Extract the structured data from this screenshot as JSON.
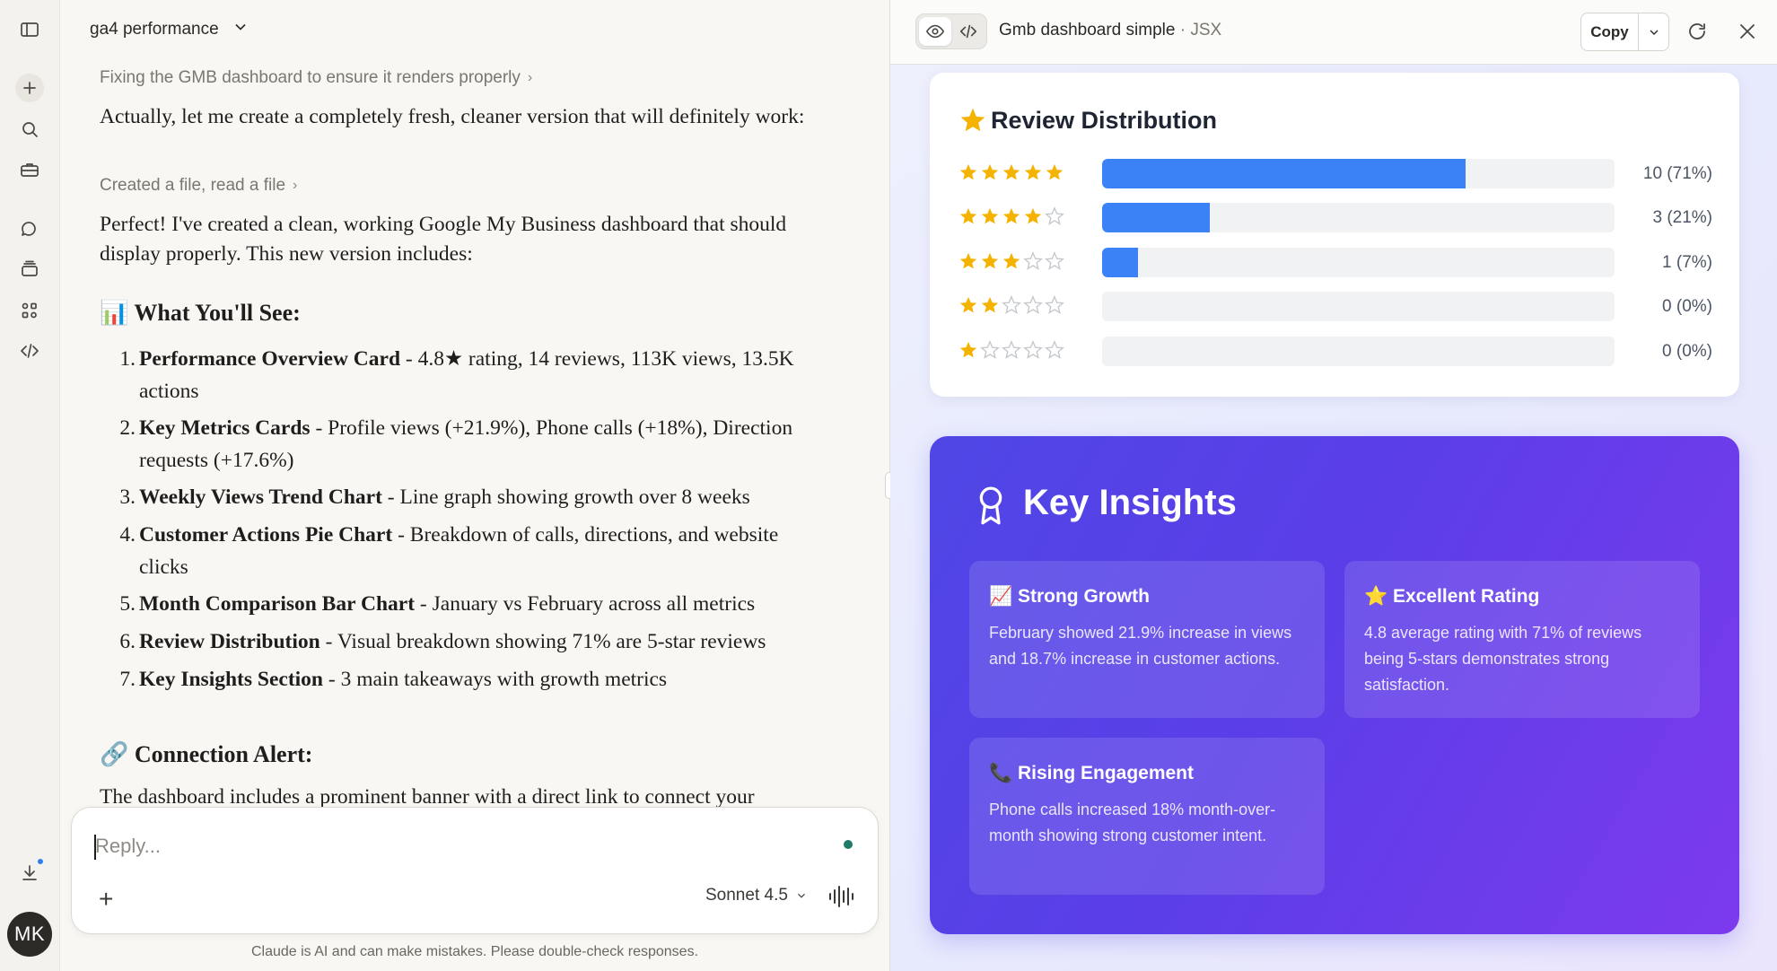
{
  "chat": {
    "title": "ga4 performance",
    "crumb1": "Fixing the GMB dashboard to ensure it renders properly",
    "para1": "Actually, let me create a completely fresh, cleaner version that will definitely work:",
    "crumb2": "Created a file, read a file",
    "para2": "Perfect! I've created a clean, working Google My Business dashboard that should display properly. This new version includes:",
    "heading1": "📊 What You'll See:",
    "list": [
      {
        "num": "1.",
        "bold": "Performance Overview Card",
        "rest": " - 4.8★ rating, 14 reviews, 113K views, 13.5K actions"
      },
      {
        "num": "2.",
        "bold": "Key Metrics Cards",
        "rest": " - Profile views (+21.9%), Phone calls (+18%), Direction requests (+17.6%)"
      },
      {
        "num": "3.",
        "bold": "Weekly Views Trend Chart",
        "rest": " - Line graph showing growth over 8 weeks"
      },
      {
        "num": "4.",
        "bold": "Customer Actions Pie Chart",
        "rest": " - Breakdown of calls, directions, and website clicks"
      },
      {
        "num": "5.",
        "bold": "Month Comparison Bar Chart",
        "rest": " - January vs February across all metrics"
      },
      {
        "num": "6.",
        "bold": "Review Distribution",
        "rest": " - Visual breakdown showing 71% are 5-star reviews"
      },
      {
        "num": "7.",
        "bold": "Key Insights Section",
        "rest": " - 3 main takeaways with growth metrics"
      }
    ],
    "heading2": "🔗 Connection Alert:",
    "para3": "The dashboard includes a prominent banner with a direct link to connect your",
    "reply_placeholder": "Reply...",
    "model": "Sonnet 4.5",
    "disclaimer": "Claude is AI and can make mistakes. Please double-check responses.",
    "avatar": "MK"
  },
  "artifact": {
    "title": "Gmb dashboard simple",
    "type": " · JSX",
    "copy_label": "Copy",
    "reviews": {
      "title": "Review Distribution",
      "star_color": "#f5b301",
      "bar_color": "#3b82f6",
      "rows": [
        {
          "stars": 5,
          "fraction": 0.71,
          "label": "10 (71%)"
        },
        {
          "stars": 4,
          "fraction": 0.21,
          "label": "3 (21%)"
        },
        {
          "stars": 3,
          "fraction": 0.07,
          "label": "1 (7%)"
        },
        {
          "stars": 2,
          "fraction": 0.0,
          "label": "0 (0%)"
        },
        {
          "stars": 1,
          "fraction": 0.0,
          "label": "0 (0%)"
        }
      ]
    },
    "insights": {
      "title": "Key Insights",
      "cards": [
        {
          "title": "📈 Strong Growth",
          "text": "February showed 21.9% increase in views and 18.7% increase in customer actions."
        },
        {
          "title": "⭐ Excellent Rating",
          "text": "4.8 average rating with 71% of reviews being 5-stars demonstrates strong satisfaction."
        },
        {
          "title": "📞 Rising Engagement",
          "text": "Phone calls increased 18% month-over-month showing strong customer intent."
        }
      ]
    }
  }
}
